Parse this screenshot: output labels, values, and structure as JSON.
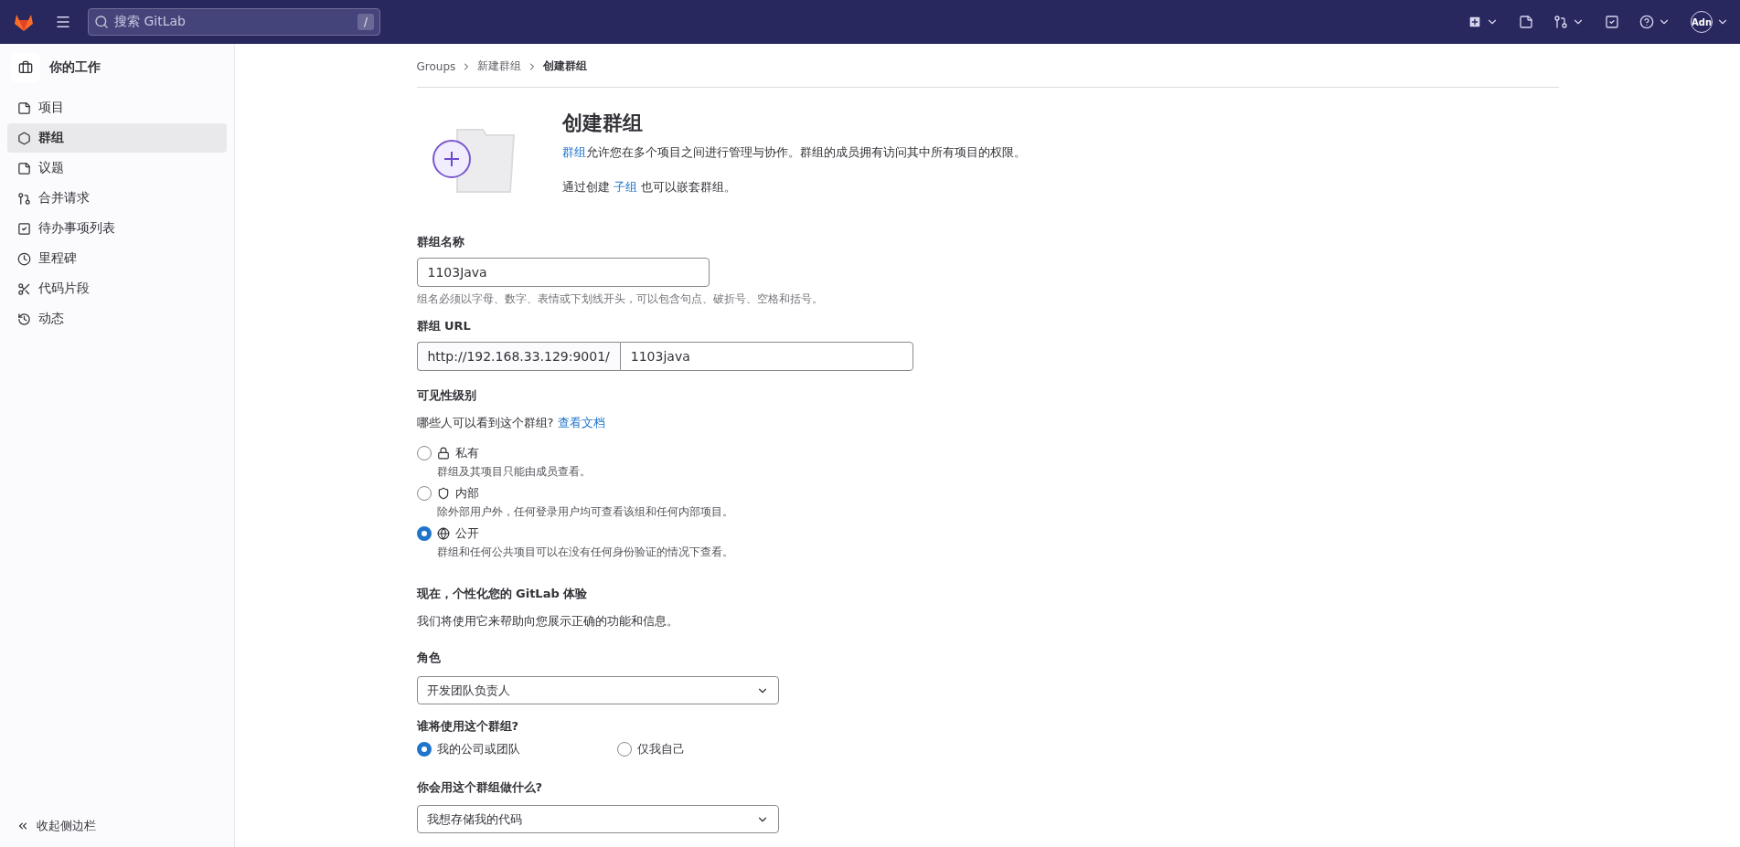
{
  "topbar": {
    "search": {
      "placeholder": "搜索 GitLab",
      "shortcut": "/"
    },
    "avatar": "Adn"
  },
  "sidebar": {
    "title": "你的工作",
    "items": [
      {
        "label": "项目",
        "selected": false
      },
      {
        "label": "群组",
        "selected": true
      },
      {
        "label": "议题",
        "selected": false
      },
      {
        "label": "合并请求",
        "selected": false
      },
      {
        "label": "待办事项列表",
        "selected": false
      },
      {
        "label": "里程碑",
        "selected": false
      },
      {
        "label": "代码片段",
        "selected": false
      },
      {
        "label": "动态",
        "selected": false
      }
    ],
    "collapse": "收起侧边栏"
  },
  "breadcrumb": [
    "Groups",
    "新建群组",
    "创建群组"
  ],
  "header": {
    "title": "创建群组",
    "description": {
      "link": "群组",
      "text": "允许您在多个项目之间进行管理与协作。群组的成员拥有访问其中所有项目的权限。"
    },
    "nested": {
      "before": "通过创建",
      "link": "子组",
      "after": "也可以嵌套群组。"
    }
  },
  "form": {
    "name": {
      "label": "群组名称",
      "value": "1103Java",
      "help": "组名必须以字母、数字、表情或下划线开头，可以包含句点、破折号、空格和括号。"
    },
    "url": {
      "label": "群组 URL",
      "prefix": "http://192.168.33.129:9001/",
      "value": "1103java"
    },
    "visibility": {
      "label": "可见性级别",
      "question": "哪些人可以看到这个群组?",
      "link": "查看文档",
      "options": [
        {
          "label": "私有",
          "description": "群组及其项目只能由成员查看。",
          "selected": false
        },
        {
          "label": "内部",
          "description": "除外部用户外，任何登录用户均可查看该组和任何内部项目。",
          "selected": false
        },
        {
          "label": "公开",
          "description": "群组和任何公共项目可以在没有任何身份验证的情况下查看。",
          "selected": true
        }
      ]
    },
    "personalize": {
      "title": "现在，个性化您的 GitLab 体验",
      "description": "我们将使用它来帮助向您展示正确的功能和信息。"
    },
    "role": {
      "label": "角色",
      "value": "开发团队负责人"
    },
    "who": {
      "label": "谁将使用这个群组?",
      "options": [
        {
          "label": "我的公司或团队",
          "selected": true
        },
        {
          "label": "仅我自己",
          "selected": false
        }
      ]
    },
    "purpose": {
      "label": "你会用这个群组做什么?",
      "value": "我想存储我的代码"
    }
  }
}
